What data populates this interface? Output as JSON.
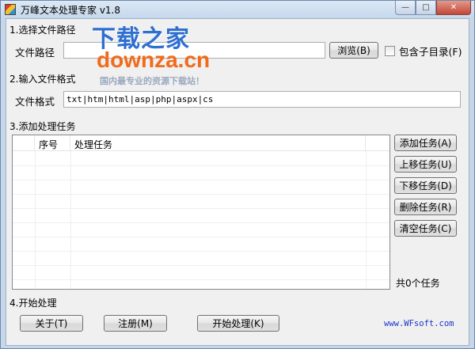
{
  "window": {
    "title": "万峰文本处理专家 v1.8",
    "minimize_glyph": "—",
    "maximize_glyph": "□",
    "close_glyph": "✕"
  },
  "section1": {
    "title": "1.选择文件路径",
    "path_label": "文件路径",
    "path_value": "",
    "browse_button": "浏览(B)",
    "include_subdir_label": "包含子目录(F)",
    "include_subdir_checked": false
  },
  "section2": {
    "title": "2.输入文件格式",
    "format_label": "文件格式",
    "format_value": "txt|htm|html|asp|php|aspx|cs"
  },
  "section3": {
    "title": "3.添加处理任务",
    "table": {
      "columns": [
        "序号",
        "处理任务"
      ],
      "rows": []
    },
    "buttons": {
      "add": "添加任务(A)",
      "up": "上移任务(U)",
      "down": "下移任务(D)",
      "delete": "删除任务(R)",
      "clear": "清空任务(C)"
    },
    "count_text": "共0个任务"
  },
  "section4": {
    "title": "4.开始处理",
    "about_button": "关于(T)",
    "register_button": "注册(M)",
    "start_button": "开始处理(K)",
    "site_link": "www.WFsoft.com"
  },
  "watermark": {
    "cn": "下载之家",
    "en": "downza.cn",
    "sub": "国内最专业的资源下载站！"
  },
  "colors": {
    "link": "#1a36c8",
    "watermark_blue": "#2e6fd0",
    "watermark_orange": "#f06b1a"
  }
}
